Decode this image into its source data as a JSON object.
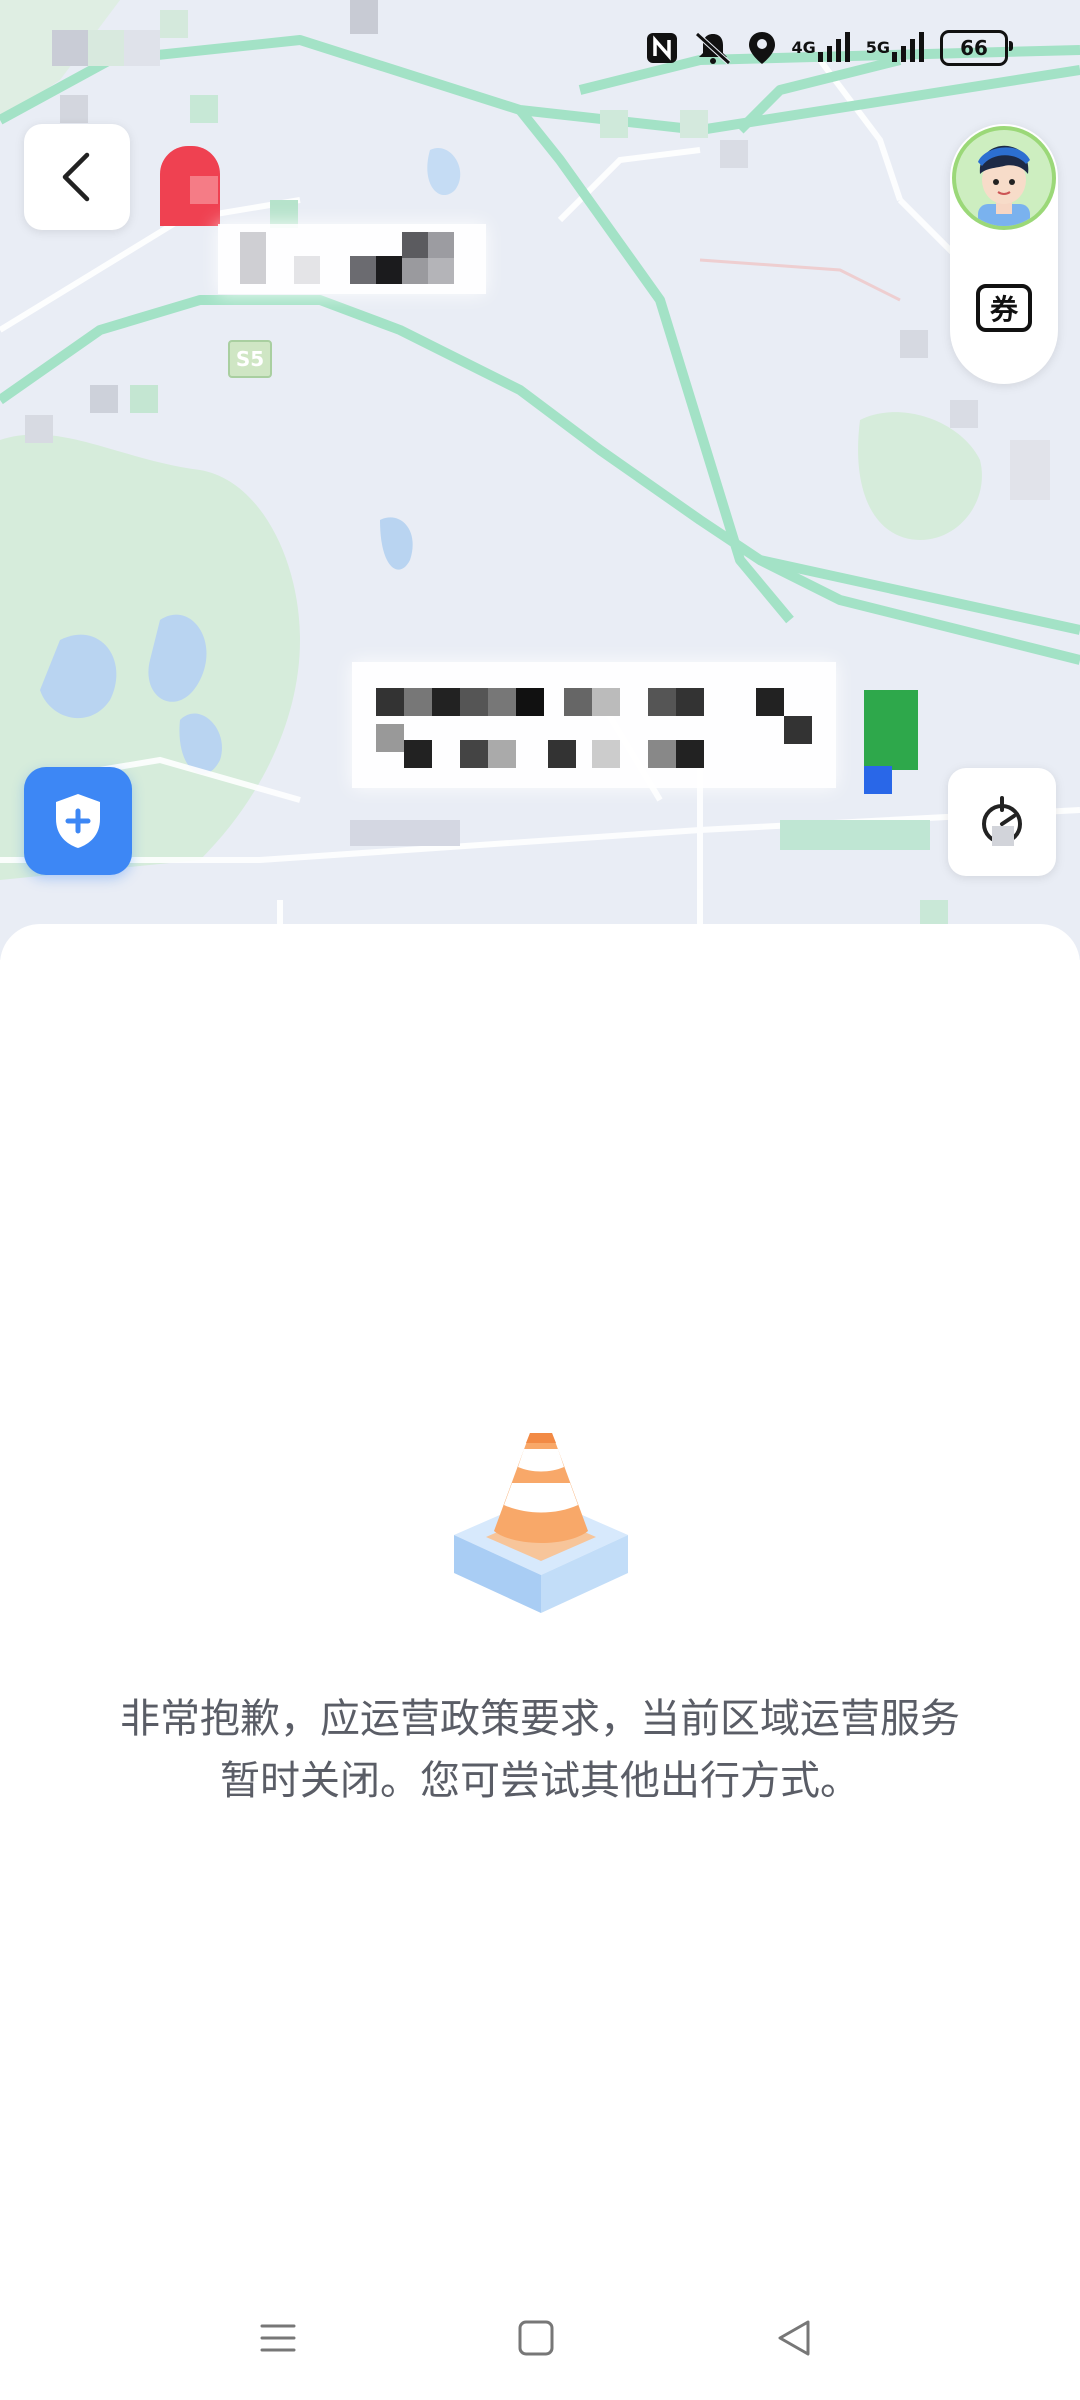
{
  "status_bar": {
    "network_1": "4G",
    "network_2": "5G",
    "battery_level": "66",
    "icons": [
      "nfc-icon",
      "mute-icon",
      "location-icon",
      "signal-icon",
      "signal-icon",
      "battery-icon"
    ]
  },
  "map": {
    "road_shield": "S5",
    "buttons": {
      "back": "chevron-left-icon",
      "coupon_label": "券",
      "safety": "shield-plus-icon",
      "locate": "locate-icon"
    },
    "colors": {
      "background": "#e9edf5",
      "road_green": "#9fe0c2",
      "water": "#b7d2f2",
      "park": "#cfe9d4",
      "safety_button": "#3d87f5"
    }
  },
  "notice": {
    "icon": "traffic-cone-icon",
    "line_1": "非常抱歉，应运营政策要求，当前区域运营服务",
    "line_2": "暂时关闭。您可尝试其他出行方式。"
  },
  "nav_bar": {
    "icons": [
      "menu-icon",
      "home-icon",
      "back-triangle-icon"
    ]
  }
}
